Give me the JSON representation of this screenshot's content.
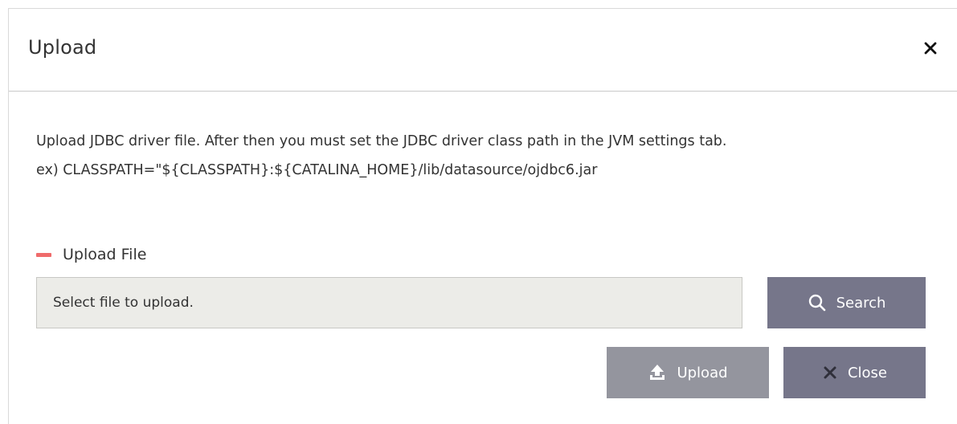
{
  "dialog": {
    "title": "Upload"
  },
  "description": {
    "line1": "Upload JDBC driver file. After then you must set the JDBC driver class path in the JVM settings tab.",
    "line2": "ex) CLASSPATH=\"${CLASSPATH}:${CATALINA_HOME}/lib/datasource/ojdbc6.jar"
  },
  "upload_section": {
    "label": "Upload File",
    "file_field_text": "Select file to upload.",
    "search_label": "Search"
  },
  "footer": {
    "upload_label": "Upload",
    "close_label": "Close"
  },
  "icons": {
    "close": "close-icon",
    "section_marker": "minus-marker-icon",
    "search": "search-icon",
    "upload": "upload-icon",
    "close_button": "x-icon"
  },
  "colors": {
    "section_marker": "#ef6b6b",
    "button_primary": "#76768a",
    "button_disabled": "#94959e",
    "file_field_bg": "#ecece8"
  }
}
